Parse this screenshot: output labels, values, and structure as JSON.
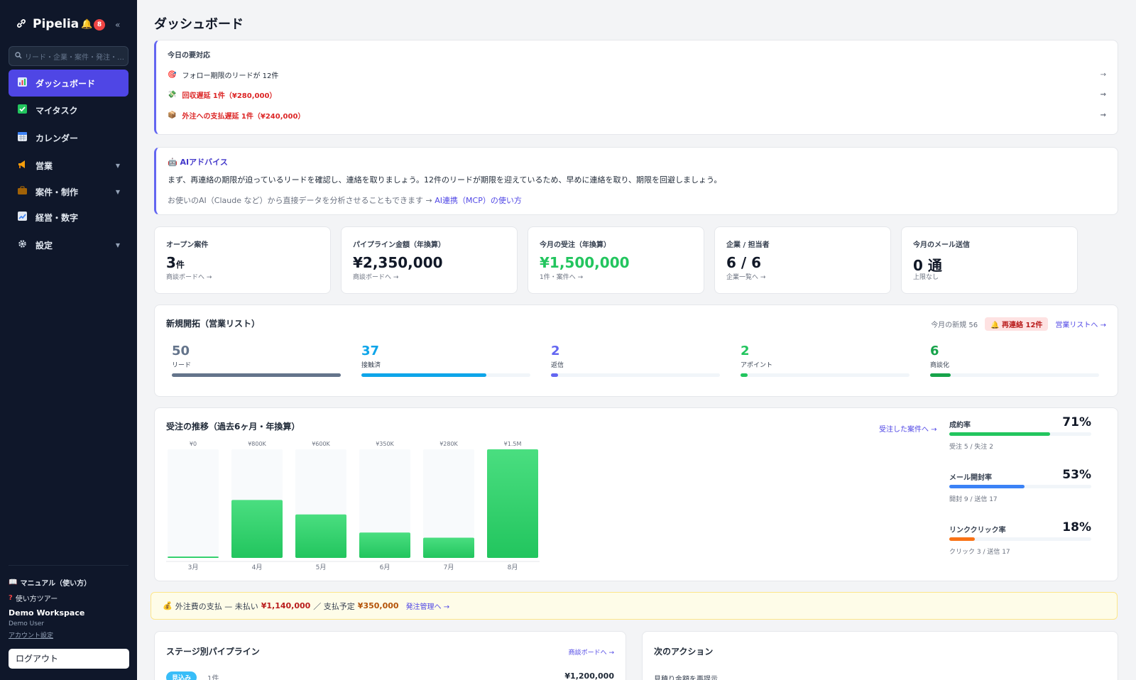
{
  "app": {
    "name": "Pipelia",
    "notif_count": "8",
    "collapse": "«"
  },
  "search": {
    "placeholder": "リード・企業・案件・発注・…"
  },
  "nav": [
    {
      "label": "ダッシュボード",
      "icon": "chart-icon"
    },
    {
      "label": "マイタスク",
      "icon": "check-icon"
    },
    {
      "label": "カレンダー",
      "icon": "calendar-icon"
    },
    {
      "label": "営業",
      "icon": "megaphone-icon"
    },
    {
      "label": "案件・制作",
      "icon": "briefcase-icon"
    },
    {
      "label": "経営・数字",
      "icon": "trend-icon"
    },
    {
      "label": "設定",
      "icon": "gear-icon"
    }
  ],
  "sidebar_bottom": {
    "manual": "マニュアル（使い方）",
    "tour": "使い方ツアー",
    "workspace": "Demo Workspace",
    "user": "Demo User",
    "account": "アカウント設定",
    "logout": "ログアウト"
  },
  "page": {
    "title": "ダッシュボード"
  },
  "todo": {
    "title": "今日の要対応",
    "items": [
      {
        "icon": "target-icon",
        "text": "フォロー期限のリードが 12件",
        "arrow": "→"
      },
      {
        "icon": "money-icon",
        "text": "回収遅延 1件（¥280,000）",
        "arrow": "→"
      },
      {
        "icon": "box-icon",
        "text": "外注への支払遅延 1件（¥240,000）",
        "arrow": "→"
      }
    ]
  },
  "ai": {
    "title": "AIアドバイス",
    "text": "まず、再連絡の期限が迫っているリードを確認し、連絡を取りましょう。12件のリードが期限を迎えているため、早めに連絡を取り、期限を回避しましょう。",
    "sub_prefix": "お使いのAI（Claude など）から直接データを分析させることもできます →",
    "sub_link": "AI連携（MCP）の使い方"
  },
  "kpis": [
    {
      "label": "オープン案件",
      "value": "3",
      "unit": "件",
      "sub": "商談ボードへ →"
    },
    {
      "label": "パイプライン金額（年換算）",
      "value": "¥2,350,000",
      "unit": "",
      "sub": "商談ボードへ →"
    },
    {
      "label": "今月の受注（年換算）",
      "value": "¥1,500,000",
      "unit": "",
      "sub": "1件・案件へ →"
    },
    {
      "label": "企業 / 担当者",
      "value": "6 / 6",
      "unit": "",
      "sub": "企業一覧へ →"
    },
    {
      "label": "今月のメール送信",
      "value": "0 通",
      "unit": "",
      "sub": "上限なし"
    }
  ],
  "funnel": {
    "title": "新規開拓（営業リスト）",
    "new_this_month": "今月の新規 56",
    "recontact": "再連絡 12件",
    "link": "営業リストへ →",
    "stages": [
      {
        "num": "50",
        "label": "リード",
        "pct": 100,
        "color": "#64748b"
      },
      {
        "num": "37",
        "label": "接触済",
        "pct": 74,
        "color": "#0ea5e9"
      },
      {
        "num": "2",
        "label": "返信",
        "pct": 4,
        "color": "#6366f1"
      },
      {
        "num": "2",
        "label": "アポイント",
        "pct": 4,
        "color": "#22c55e"
      },
      {
        "num": "6",
        "label": "商談化",
        "pct": 12,
        "color": "#16a34a"
      }
    ]
  },
  "orders": {
    "title": "受注の推移（過去6ヶ月・年換算）",
    "link": "受注した案件へ →"
  },
  "chart_data": {
    "type": "bar",
    "categories": [
      "3月",
      "4月",
      "5月",
      "6月",
      "7月",
      "8月"
    ],
    "values": [
      0,
      800000,
      600000,
      350000,
      280000,
      1500000
    ],
    "data_labels": [
      "¥0",
      "¥800K",
      "¥600K",
      "¥350K",
      "¥280K",
      "¥1.5M"
    ],
    "ylim": [
      0,
      1500000
    ],
    "color": "#22c55e"
  },
  "rates": [
    {
      "label": "成約率",
      "value": "71%",
      "pct": 71,
      "sub": "受注 5 / 失注 2",
      "color": "#22c55e"
    },
    {
      "label": "メール開封率",
      "value": "53%",
      "pct": 53,
      "sub": "開封 9 / 送信 17",
      "color": "#3b82f6"
    },
    {
      "label": "リンククリック率",
      "value": "18%",
      "pct": 18,
      "sub": "クリック 3 / 送信 17",
      "color": "#f97316"
    }
  ],
  "notice": {
    "prefix": "外注費の支払 — 未払い",
    "unpaid": "¥1,140,000",
    "mid": "／ 支払予定",
    "scheduled": "¥350,000",
    "link": "発注管理へ →"
  },
  "pipeline": {
    "title": "ステージ別パイプライン",
    "link": "商談ボードへ →",
    "first_stage": "見込み",
    "first_count": "1件",
    "first_amount": "¥1,200,000"
  },
  "next_actions": {
    "title": "次のアクション",
    "first_item": "見積り金額を再提示"
  }
}
